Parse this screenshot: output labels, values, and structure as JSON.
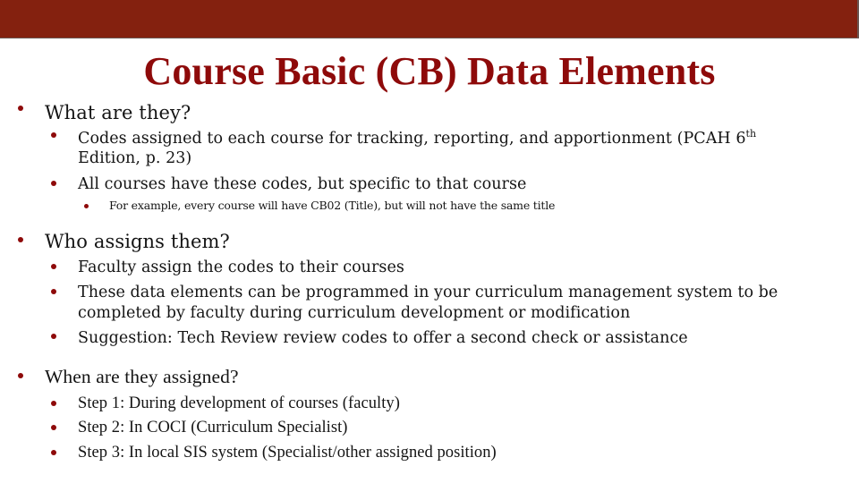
{
  "slide": {
    "title": "Course Basic (CB) Data Elements",
    "colors": {
      "banner": "#84210f",
      "title": "#8e0a0a",
      "bullet": "#8e0a0a",
      "text": "#141414"
    }
  },
  "sections": [
    {
      "heading": "What are they?",
      "items": [
        {
          "line1_before_sup": "Codes assigned to each course for tracking, reporting, and apportionment (PCAH 6",
          "sup": "th",
          "line2": "Edition, p. 23)"
        },
        {
          "text": "All courses have these codes, but specific to that course",
          "subitems": [
            "For example, every course will have CB02 (Title), but will not have the same title"
          ]
        }
      ]
    },
    {
      "heading": "Who assigns them?",
      "items": [
        {
          "text": "Faculty assign the codes to their courses"
        },
        {
          "line1": "These data elements can be programmed in your curriculum management system to be",
          "line2": "completed by faculty during curriculum development or modification"
        },
        {
          "text": "Suggestion: Tech Review review codes to offer a second check or assistance"
        }
      ]
    },
    {
      "heading": "When are they assigned?",
      "items": [
        {
          "text": "Step 1: During development of courses (faculty)"
        },
        {
          "text": "Step 2: In COCI (Curriculum Specialist)"
        },
        {
          "text": "Step 3: In local SIS system (Specialist/other assigned position)"
        }
      ]
    }
  ]
}
